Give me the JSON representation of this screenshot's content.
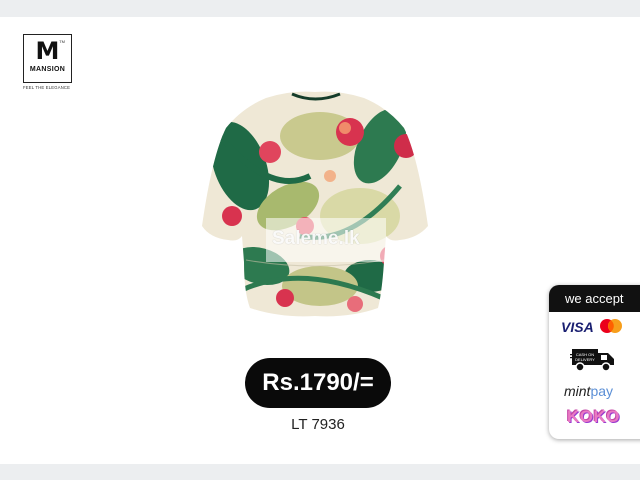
{
  "brand": {
    "logo_letter": "M",
    "trademark": "TM",
    "name": "MANSION",
    "tagline": "FEEL THE ELEGANCE"
  },
  "product": {
    "image": "floral-print-crop-top",
    "watermark": "Saleme.lk",
    "price": "Rs.1790/=",
    "code": "LT 7936"
  },
  "payments": {
    "heading": "we accept",
    "methods": {
      "visa": "VISA",
      "mastercard": "mastercard",
      "cod_line1": "CASH ON",
      "cod_line2": "DELIVERY",
      "mintpay_a": "mint",
      "mintpay_b": "pay",
      "koko": "KOKO"
    }
  },
  "colors": {
    "background": "#eceef0",
    "card": "#ffffff",
    "price_bg": "#0a0a0a",
    "visa_blue": "#1a1f71",
    "koko_pink": "#e979c3",
    "leaf_green": "#1f6a46",
    "flower_red": "#d8334f"
  }
}
